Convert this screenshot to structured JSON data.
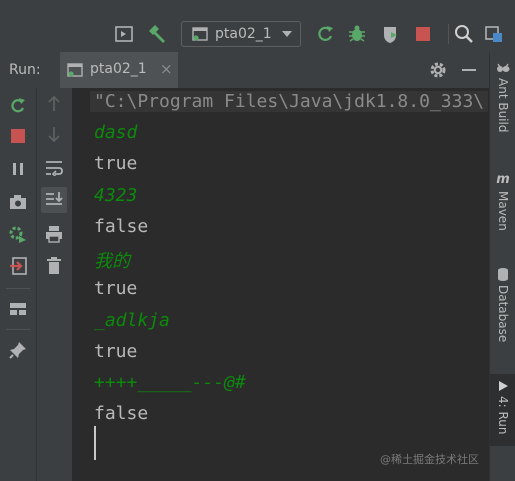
{
  "toolbar": {
    "run_config": "pta02_1",
    "icons": [
      "run-anything-icon",
      "build-hammer-icon",
      "rerun-icon",
      "debug-bug-icon",
      "coverage-icon",
      "stop-icon",
      "search-icon",
      "project-structure-icon"
    ]
  },
  "run_panel": {
    "label": "Run:",
    "tab_label": "pta02_1",
    "tab_close": "×"
  },
  "console": {
    "command": "\"C:\\Program Files\\Java\\jdk1.8.0_333\\",
    "lines": [
      {
        "text": "dasd",
        "kind": "input"
      },
      {
        "text": "true",
        "kind": "output"
      },
      {
        "text": "4323",
        "kind": "input"
      },
      {
        "text": "false",
        "kind": "output"
      },
      {
        "text": "我的",
        "kind": "input"
      },
      {
        "text": "true",
        "kind": "output"
      },
      {
        "text": "_adlkja",
        "kind": "input"
      },
      {
        "text": "true",
        "kind": "output"
      },
      {
        "text": "++++_____---@#",
        "kind": "input"
      },
      {
        "text": "false",
        "kind": "output"
      }
    ],
    "watermark": "@稀土掘金技术社区"
  },
  "right_bar": {
    "tabs": [
      "Ant Build",
      "Maven",
      "Database",
      "4: Run"
    ]
  },
  "colors": {
    "input_text": "#0b8a0b",
    "output_text": "#b9b9b9",
    "green_icon": "#59a869",
    "red_icon": "#c75450"
  }
}
